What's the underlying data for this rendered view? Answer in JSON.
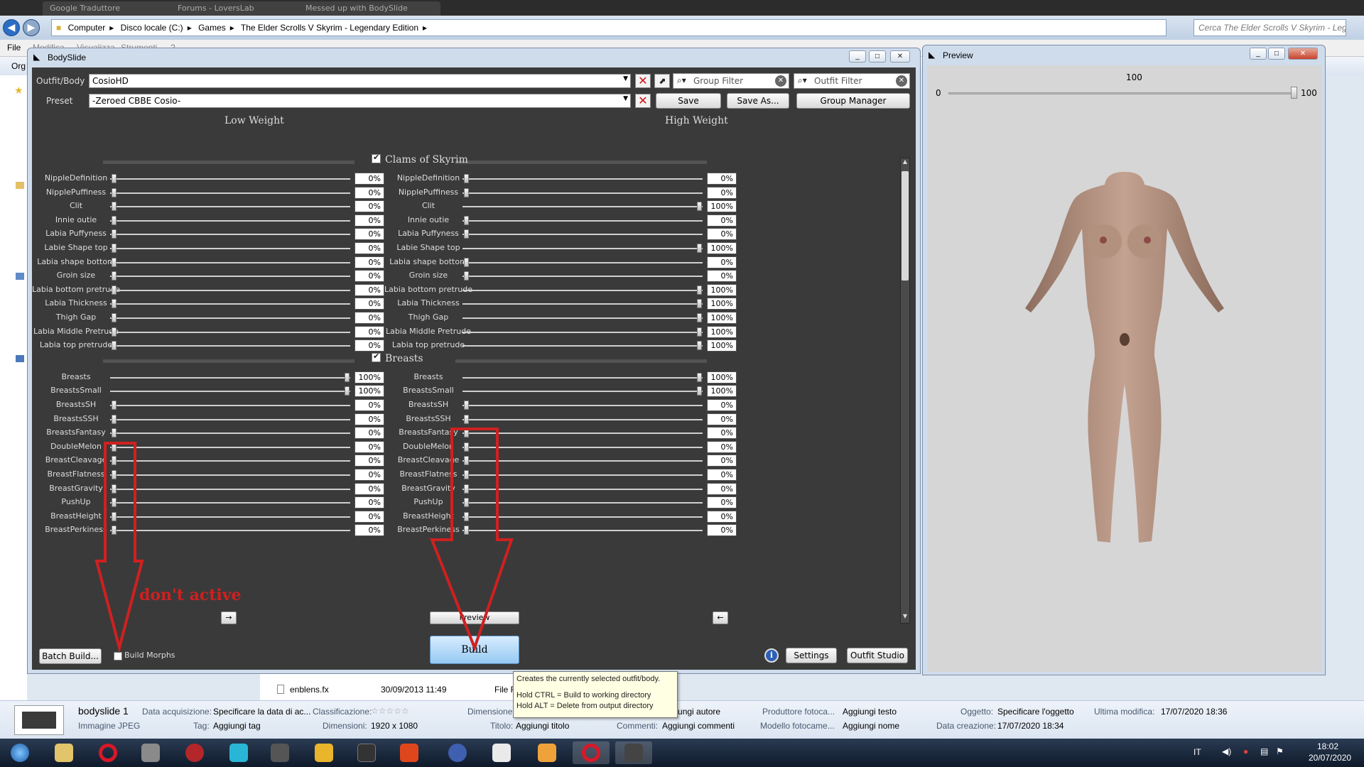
{
  "explorer": {
    "browser_tabs": [
      "Google Traduttore",
      "Forums - LoversLab",
      "Messed up with BodySlide"
    ],
    "address_path": [
      "Computer",
      "Disco locale (C:)",
      "Games",
      "The Elder Scrolls V Skyrim - Legendary Edition"
    ],
    "search_placeholder": "Cerca The Elder Scrolls V Skyrim - Leg...",
    "menu": [
      "File",
      "Modifica",
      "Visualizza",
      "Strumenti",
      "?"
    ],
    "org_label": "Org",
    "file_rows": [
      {
        "name": "enblens.fx",
        "date": "30/09/2013 11:49",
        "type": "File F"
      }
    ]
  },
  "details": {
    "file_name": "bodyslide 1",
    "file_type": "Immagine JPEG",
    "fields": [
      {
        "label": "Data acquisizione:",
        "value": "Specificare la data di ac..."
      },
      {
        "label": "Classificazione:",
        "value": "☆☆☆☆☆"
      },
      {
        "label": "Dimensione",
        "value": ""
      },
      {
        "label": "",
        "value": "Aggiungi autore"
      },
      {
        "label": "Produttore fotoca...",
        "value": "Aggiungi testo"
      },
      {
        "label": "Oggetto:",
        "value": "Specificare l'oggetto"
      },
      {
        "label": "Ultima modifica:",
        "value": "17/07/2020 18:36"
      },
      {
        "label": "Tag:",
        "value": "Aggiungi tag"
      },
      {
        "label": "Dimensioni:",
        "value": "1920 x 1080"
      },
      {
        "label": "Titolo:",
        "value": "Aggiungi titolo"
      },
      {
        "label": "Commenti:",
        "value": "Aggiungi commenti"
      },
      {
        "label": "Modello fotocame...",
        "value": "Aggiungi nome"
      },
      {
        "label": "Data creazione:",
        "value": "17/07/2020 18:34"
      }
    ]
  },
  "bodyslide": {
    "title": "BodySlide",
    "outfit_label": "Outfit/Body",
    "outfit_value": "CosioHD",
    "preset_label": "Preset",
    "preset_value": "-Zeroed CBBE Cosio-",
    "group_filter_placeholder": "Group Filter",
    "outfit_filter_placeholder": "Outfit Filter",
    "save_label": "Save",
    "save_as_label": "Save As...",
    "group_manager_label": "Group Manager",
    "low_weight": "Low Weight",
    "high_weight": "High Weight",
    "groups": [
      {
        "name": "Clams of Skyrim",
        "sliders": [
          {
            "name": "NippleDefinition",
            "low": "0%",
            "high": "0%"
          },
          {
            "name": "NipplePuffiness",
            "low": "0%",
            "high": "0%"
          },
          {
            "name": "Clit",
            "low": "0%",
            "high": "100%"
          },
          {
            "name": "Innie outie",
            "low": "0%",
            "high": "0%"
          },
          {
            "name": "Labia Puffyness",
            "low": "0%",
            "high": "0%"
          },
          {
            "name": "Labie Shape top",
            "low": "0%",
            "high": "100%"
          },
          {
            "name": "Labia shape bottom",
            "low": "0%",
            "high": "0%"
          },
          {
            "name": "Groin size",
            "low": "0%",
            "high": "0%"
          },
          {
            "name": "Labia bottom pretrude",
            "low": "0%",
            "high": "100%"
          },
          {
            "name": "Labia Thickness",
            "low": "0%",
            "high": "100%"
          },
          {
            "name": "Thigh Gap",
            "low": "0%",
            "high": "100%"
          },
          {
            "name": "Labia Middle Pretrude",
            "low": "0%",
            "high": "100%"
          },
          {
            "name": "Labia top pretrude",
            "low": "0%",
            "high": "100%"
          }
        ]
      },
      {
        "name": "Breasts",
        "sliders": [
          {
            "name": "Breasts",
            "low": "100%",
            "high": "100%"
          },
          {
            "name": "BreastsSmall",
            "low": "100%",
            "high": "100%"
          },
          {
            "name": "BreastsSH",
            "low": "0%",
            "high": "0%"
          },
          {
            "name": "BreastsSSH",
            "low": "0%",
            "high": "0%"
          },
          {
            "name": "BreastsFantasy",
            "low": "0%",
            "high": "0%"
          },
          {
            "name": "DoubleMelon",
            "low": "0%",
            "high": "0%"
          },
          {
            "name": "BreastCleavage",
            "low": "0%",
            "high": "0%"
          },
          {
            "name": "BreastFlatness",
            "low": "0%",
            "high": "0%"
          },
          {
            "name": "BreastGravity",
            "low": "0%",
            "high": "0%"
          },
          {
            "name": "PushUp",
            "low": "0%",
            "high": "0%"
          },
          {
            "name": "BreastHeight",
            "low": "0%",
            "high": "0%"
          },
          {
            "name": "BreastPerkiness",
            "low": "0%",
            "high": "0%"
          }
        ]
      }
    ],
    "arrow_right_label": "→",
    "arrow_left_label": "←",
    "preview_label": "Preview",
    "build_label": "Build",
    "batch_build_label": "Batch Build...",
    "build_morphs_label": "Build Morphs",
    "settings_label": "Settings",
    "outfit_studio_label": "Outfit Studio",
    "info_label": "i",
    "annotation_text": "don't active"
  },
  "tooltip": {
    "line1": "Creates the currently selected outfit/body.",
    "line2": "Hold CTRL = Build to working directory",
    "line3": "Hold ALT = Delete from output directory"
  },
  "preview": {
    "title": "Preview",
    "slider_value": "100",
    "slider_min": "0",
    "slider_max": "100",
    "weight_fraction": 1.0
  },
  "taskbar": {
    "language": "IT",
    "time": "18:02",
    "date": "20/07/2020"
  },
  "colors": {
    "annotation": "#d02020",
    "bodyslide_bg": "#3a3a3a",
    "build_button": "#96c9f2",
    "skin": "#b08e7c"
  }
}
